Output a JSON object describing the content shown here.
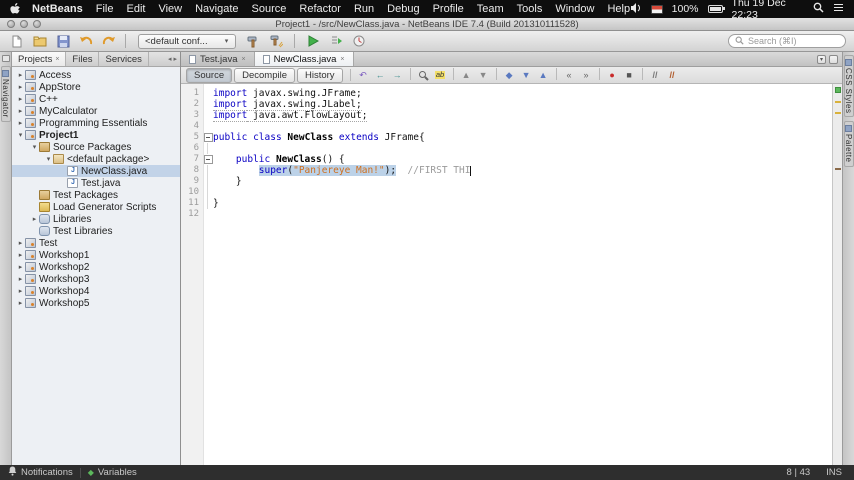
{
  "colors": {
    "kw": "#0a00c4",
    "str": "#cf6f1f",
    "cm": "#9b9b9b",
    "sel": "#bcd2e8"
  },
  "menubar": {
    "items": [
      "NetBeans",
      "File",
      "Edit",
      "View",
      "Navigate",
      "Source",
      "Refactor",
      "Run",
      "Debug",
      "Profile",
      "Team",
      "Tools",
      "Window",
      "Help"
    ],
    "battery_percent": "100%",
    "clock": "Thu 19 Dec 22:23"
  },
  "window": {
    "title": "Project1 - /src/NewClass.java - NetBeans IDE 7.4 (Build 201310111528)"
  },
  "toolbar": {
    "config_value": "<default conf...",
    "search_placeholder": "Search (⌘I)",
    "left_buttons": [
      "new-file-icon",
      "open-project-icon",
      "save-all-icon",
      "undo-icon",
      "redo-icon"
    ],
    "right_buttons": [
      "build-project-icon",
      "clean-build-icon",
      "run-project-icon",
      "debug-project-icon",
      "profile-project-icon"
    ]
  },
  "left_dock": {
    "tab": "Navigator"
  },
  "right_dock": {
    "tabs": [
      "CSS Styles",
      "Palette"
    ]
  },
  "projects_panel": {
    "tabs": [
      {
        "label": "Projects",
        "active": true
      },
      {
        "label": "Files"
      },
      {
        "label": "Services"
      }
    ],
    "tree": [
      {
        "label": "Access",
        "indent": 0,
        "icon": "project",
        "expand": "closed"
      },
      {
        "label": "AppStore",
        "indent": 0,
        "icon": "project",
        "expand": "closed"
      },
      {
        "label": "C++",
        "indent": 0,
        "icon": "project",
        "expand": "closed"
      },
      {
        "label": "MyCalculator",
        "indent": 0,
        "icon": "project",
        "expand": "closed"
      },
      {
        "label": "Programming Essentials",
        "indent": 0,
        "icon": "project",
        "expand": "closed"
      },
      {
        "label": "Project1",
        "indent": 0,
        "icon": "project",
        "expand": "open",
        "bold": true
      },
      {
        "label": "Source Packages",
        "indent": 1,
        "icon": "source-folder",
        "expand": "open"
      },
      {
        "label": "<default package>",
        "indent": 2,
        "icon": "package",
        "expand": "open"
      },
      {
        "label": "NewClass.java",
        "indent": 3,
        "icon": "java-file",
        "expand": "none",
        "selected": true
      },
      {
        "label": "Test.java",
        "indent": 3,
        "icon": "java-file",
        "expand": "none"
      },
      {
        "label": "Test Packages",
        "indent": 1,
        "icon": "source-folder",
        "expand": "none"
      },
      {
        "label": "Load Generator Scripts",
        "indent": 1,
        "icon": "folder",
        "expand": "none"
      },
      {
        "label": "Libraries",
        "indent": 1,
        "icon": "libraries",
        "expand": "closed"
      },
      {
        "label": "Test Libraries",
        "indent": 1,
        "icon": "libraries",
        "expand": "none"
      },
      {
        "label": "Test",
        "indent": 0,
        "icon": "project",
        "expand": "closed"
      },
      {
        "label": "Workshop1",
        "indent": 0,
        "icon": "project",
        "expand": "closed"
      },
      {
        "label": "Workshop2",
        "indent": 0,
        "icon": "project",
        "expand": "closed"
      },
      {
        "label": "Workshop3",
        "indent": 0,
        "icon": "project",
        "expand": "closed"
      },
      {
        "label": "Workshop4",
        "indent": 0,
        "icon": "project",
        "expand": "closed"
      },
      {
        "label": "Workshop5",
        "indent": 0,
        "icon": "project",
        "expand": "closed"
      }
    ]
  },
  "editor": {
    "tabs": [
      {
        "label": "Test.java"
      },
      {
        "label": "NewClass.java",
        "active": true
      }
    ],
    "views": [
      "Source",
      "Decompile",
      "History"
    ],
    "toolbar_icons": [
      "last-edit-icon",
      "back-icon",
      "forward-icon",
      "find-selection-icon",
      "toggle-highlight-icon",
      "prev-occurrence-icon",
      "next-occurrence-icon",
      "toggle-bookmark-icon",
      "next-bookmark-icon",
      "prev-bookmark-icon",
      "shift-left-icon",
      "shift-right-icon",
      "start-macro-icon",
      "stop-macro-icon",
      "comment-icon",
      "uncomment-icon"
    ],
    "lines": [
      {
        "n": 1,
        "tokens": [
          {
            "t": "import",
            "c": "kw"
          },
          {
            "t": " javax.swing.JFrame;",
            "c": "pl"
          }
        ]
      },
      {
        "n": 2,
        "cls": "unused",
        "tokens": [
          {
            "t": "import",
            "c": "kw"
          },
          {
            "t": " javax.swing.JLabel;",
            "c": "pl"
          }
        ]
      },
      {
        "n": 3,
        "cls": "unused",
        "tokens": [
          {
            "t": "import",
            "c": "kw"
          },
          {
            "t": " java.awt.FlowLayout;",
            "c": "pl"
          }
        ]
      },
      {
        "n": 4,
        "tokens": []
      },
      {
        "n": 5,
        "fold": "minus",
        "tokens": [
          {
            "t": "public",
            "c": "kw"
          },
          {
            "t": " ",
            "c": "pl"
          },
          {
            "t": "class",
            "c": "kw"
          },
          {
            "t": " ",
            "c": "pl"
          },
          {
            "t": "NewClass",
            "c": "cls"
          },
          {
            "t": " ",
            "c": "pl"
          },
          {
            "t": "extends",
            "c": "kw"
          },
          {
            "t": " JFrame{",
            "c": "pl"
          }
        ]
      },
      {
        "n": 6,
        "fold": "guide",
        "tokens": []
      },
      {
        "n": 7,
        "fold": "minus",
        "tokens": [
          {
            "t": "    ",
            "c": "pl"
          },
          {
            "t": "public",
            "c": "kw"
          },
          {
            "t": " ",
            "c": "pl"
          },
          {
            "t": "NewClass",
            "c": "cls"
          },
          {
            "t": "() {",
            "c": "pl"
          }
        ]
      },
      {
        "n": 8,
        "fold": "guide",
        "tokens": [
          {
            "t": "        ",
            "c": "pl"
          },
          {
            "t": "super",
            "c": "kw sel"
          },
          {
            "t": "(",
            "c": "pl sel"
          },
          {
            "t": "\"Panjereye Man!\"",
            "c": "str sel"
          },
          {
            "t": ");",
            "c": "pl sel"
          },
          {
            "t": "  ",
            "c": "pl"
          },
          {
            "t": "//FIRST THI",
            "c": "cm"
          },
          {
            "t": "",
            "c": "caret"
          }
        ]
      },
      {
        "n": 9,
        "fold": "guide",
        "tokens": [
          {
            "t": "    }",
            "c": "pl"
          }
        ]
      },
      {
        "n": 10,
        "fold": "guide",
        "tokens": []
      },
      {
        "n": 11,
        "fold": "guide",
        "tokens": [
          {
            "t": "}",
            "c": "pl"
          }
        ]
      },
      {
        "n": 12,
        "tokens": []
      }
    ]
  },
  "statusbar": {
    "notifications": "Notifications",
    "variables": "Variables",
    "caret": "8 | 43",
    "mode": "INS"
  }
}
